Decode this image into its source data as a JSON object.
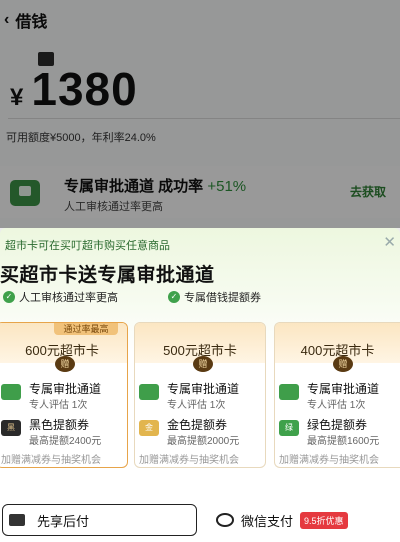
{
  "header": {
    "back_icon": "back-arrow-icon",
    "title": "借钱"
  },
  "amount": {
    "currency": "¥",
    "value": "1380"
  },
  "credit_line": "可用额度¥5000，年利率24.0%",
  "approval_card": {
    "title": "专属审批通道 成功率",
    "rate": "+51%",
    "subtitle": "人工审核通过率更高",
    "action": "去获取"
  },
  "sheet": {
    "promo": "超市卡可在买叮超市购买任意商品",
    "title": "买超市卡送专属审批通道",
    "benefits": [
      "人工审核通过率更高",
      "专属借钱提额券"
    ],
    "cards": [
      {
        "price_label": "600元超市卡",
        "tag": "通过率最高",
        "gift": "赠",
        "rows": [
          {
            "icon": "approval-icon",
            "title": "专属审批通道",
            "sub": "专人评估 1次"
          },
          {
            "icon": "coupon-icon",
            "badge": "黑",
            "title": "黑色提额券",
            "sub": "最高提额2400元"
          }
        ],
        "footer": "加赠满减券与抽奖机会"
      },
      {
        "price_label": "500元超市卡",
        "gift": "赠",
        "rows": [
          {
            "icon": "approval-icon",
            "title": "专属审批通道",
            "sub": "专人评估 1次"
          },
          {
            "icon": "coupon-icon",
            "badge": "金",
            "title": "金色提额券",
            "sub": "最高提额2000元"
          }
        ],
        "footer": "加赠满减券与抽奖机会"
      },
      {
        "price_label": "400元超市卡",
        "gift": "赠",
        "rows": [
          {
            "icon": "approval-icon",
            "title": "专属审批通道",
            "sub": "专人评估 1次"
          },
          {
            "icon": "coupon-icon",
            "badge": "绿",
            "title": "绿色提额券",
            "sub": "最高提额1600元"
          }
        ],
        "footer": "加赠满减券与抽奖机会"
      }
    ],
    "pay_later": "先享后付",
    "wechat_pay": "微信支付",
    "wechat_discount": "9.5折优惠"
  }
}
